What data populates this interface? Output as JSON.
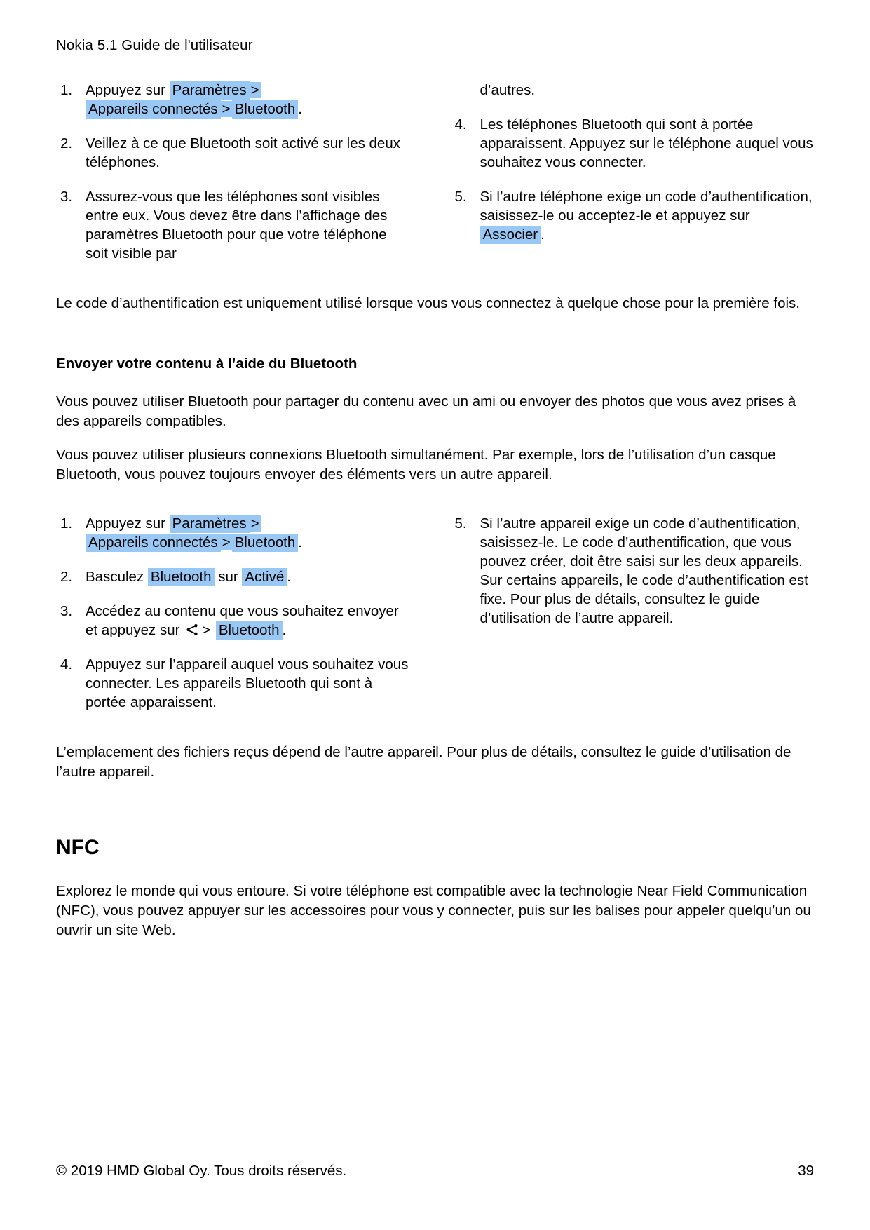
{
  "document": {
    "header": "Nokia 5.1 Guide de l'utilisateur",
    "page_number": "39",
    "copyright": "© 2019 HMD Global Oy. Tous droits réservés.",
    "highlight_color": "#9ac8f5"
  },
  "pairing_list": {
    "left": [
      {
        "num": "1.",
        "pre": "Appuyez sur",
        "chip1": "Paramètres",
        "sep1": ">",
        "chip2": "Appareils connectés",
        "sep2": ">",
        "chip3": "Bluetooth",
        "post": "."
      },
      {
        "num": "2.",
        "text": "Veillez à ce que Bluetooth soit activé sur les deux téléphones."
      },
      {
        "num": "3.",
        "text": "Assurez-vous que les téléphones sont visibles entre eux. Vous devez être dans l’affichage des paramètres Bluetooth pour que votre téléphone soit visible par"
      }
    ],
    "right": [
      {
        "continuation": "d’autres."
      },
      {
        "num": "4.",
        "text": "Les téléphones Bluetooth qui sont à portée apparaissent. Appuyez sur le téléphone auquel vous souhaitez vous connecter."
      },
      {
        "num": "5.",
        "pre": "Si l’autre téléphone exige un code d’authentification, saisissez-le ou acceptez-le et appuyez sur",
        "chip1": "Associer",
        "post": "."
      }
    ]
  },
  "auth_note": "Le code d’authentification est uniquement utilisé lorsque vous vous connectez à quelque chose pour la première fois.",
  "send_section": {
    "heading": "Envoyer votre contenu à l’aide du Bluetooth",
    "paragraphs": [
      "Vous pouvez utiliser Bluetooth pour partager du contenu avec un ami ou envoyer des photos que vous avez prises à des appareils compatibles.",
      "Vous pouvez utiliser plusieurs connexions Bluetooth simultanément. Par exemple, lors de l’utilisation d’un casque Bluetooth, vous pouvez toujours envoyer des éléments vers un autre appareil."
    ],
    "left": [
      {
        "num": "1.",
        "pre": "Appuyez sur",
        "chip1": "Paramètres",
        "sep1": ">",
        "chip2": "Appareils connectés",
        "sep2": ">",
        "chip3": "Bluetooth",
        "post": "."
      },
      {
        "num": "2.",
        "pre": "Basculez",
        "chip1": "Bluetooth",
        "mid": "sur",
        "chip2": "Activé",
        "post": "."
      },
      {
        "num": "3.",
        "pre": "Accédez au contenu que vous souhaitez envoyer et appuyez sur",
        "icon": "share-icon",
        "sep1": ">",
        "chip1": "Bluetooth",
        "post": "."
      },
      {
        "num": "4.",
        "text": "Appuyez sur l’appareil auquel vous souhaitez vous connecter. Les appareils Bluetooth qui sont à portée apparaissent."
      }
    ],
    "right": [
      {
        "num": "5.",
        "text": "Si l’autre appareil exige un code d’authentification, saisissez-le. Le code d’authentification, que vous pouvez créer, doit être saisi sur les deux appareils. Sur certains appareils, le code d’authentification est fixe. Pour plus de détails, consultez le guide d’utilisation de l’autre appareil."
      }
    ],
    "closing": "L’emplacement des fichiers reçus dépend de l’autre appareil. Pour plus de détails, consultez le guide d’utilisation de l’autre appareil."
  },
  "nfc_section": {
    "heading": "NFC",
    "paragraph": "Explorez le monde qui vous entoure. Si votre téléphone est compatible avec la technologie Near Field Communication (NFC), vous pouvez appuyer sur les accessoires pour vous y connecter, puis sur les balises pour appeler quelqu’un ou ouvrir un site Web."
  }
}
